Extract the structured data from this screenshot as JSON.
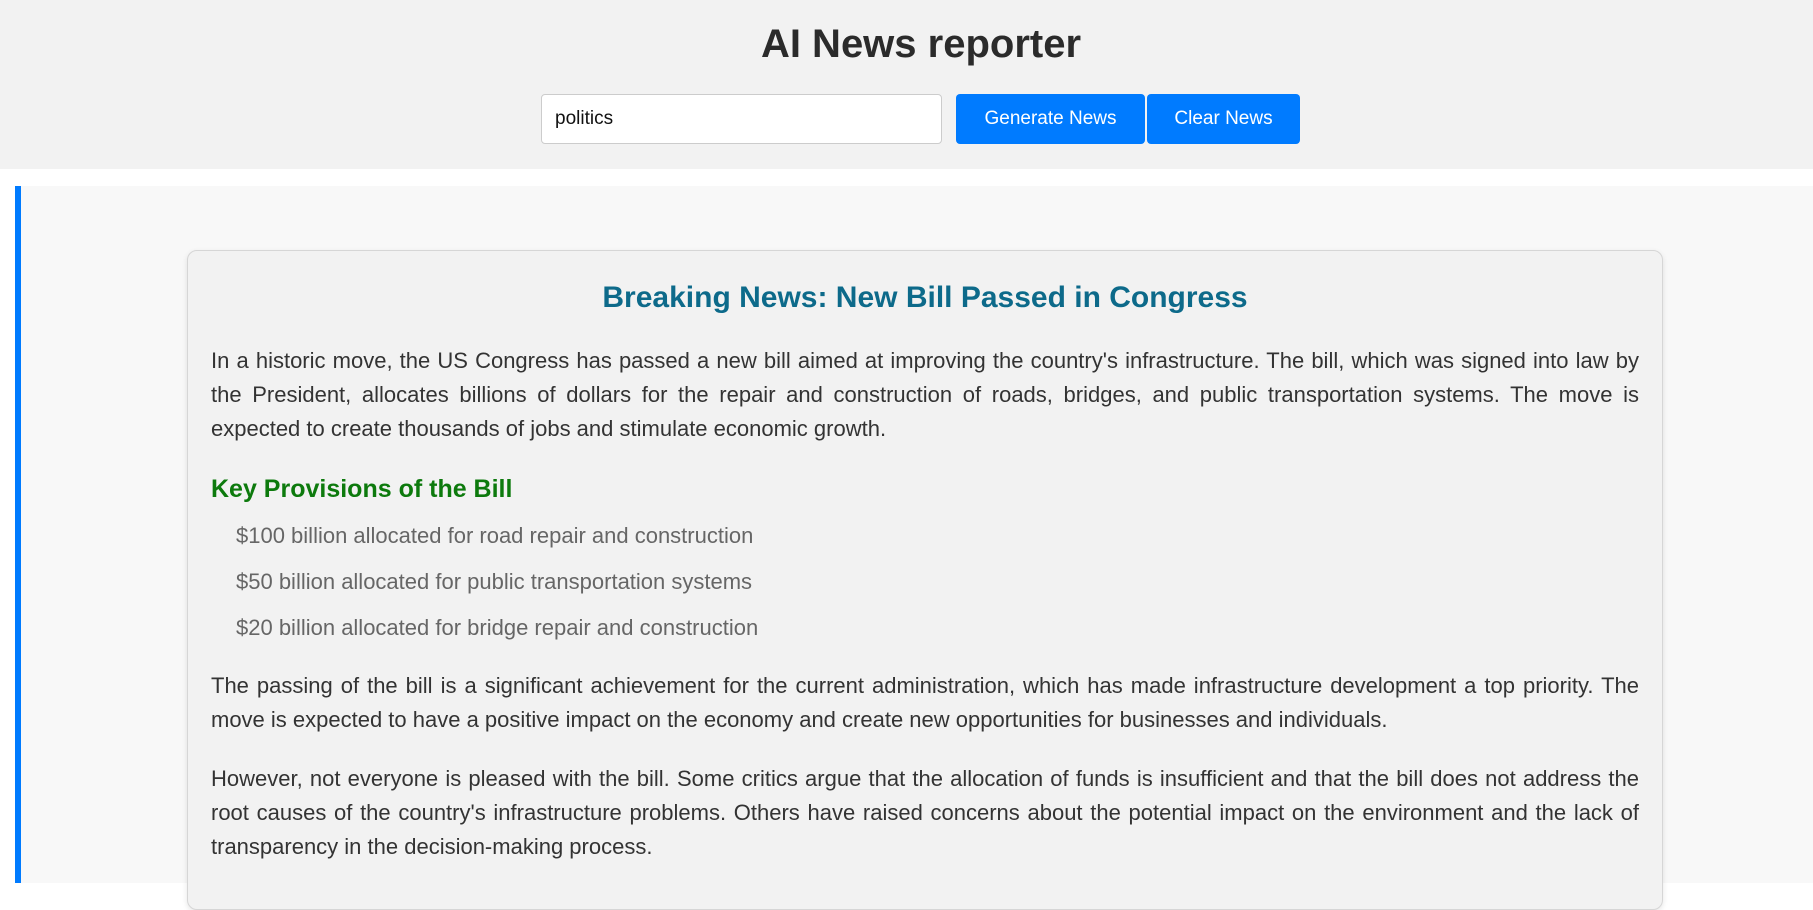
{
  "header": {
    "title": "AI News reporter",
    "topic_input_value": "politics",
    "generate_label": "Generate News",
    "clear_label": "Clear News"
  },
  "colors": {
    "accent": "#007bff",
    "title_color": "#0d6a8a",
    "heading_color": "#0d7a0d"
  },
  "article": {
    "title": "Breaking News: New Bill Passed in Congress",
    "intro": "In a historic move, the US Congress has passed a new bill aimed at improving the country's infrastructure. The bill, which was signed into law by the President, allocates billions of dollars for the repair and construction of roads, bridges, and public transportation systems. The move is expected to create thousands of jobs and stimulate economic growth.",
    "provisions_heading": "Key Provisions of the Bill",
    "provisions": [
      "$100 billion allocated for road repair and construction",
      "$50 billion allocated for public transportation systems",
      "$20 billion allocated for bridge repair and construction"
    ],
    "paragraph_2": "The passing of the bill is a significant achievement for the current administration, which has made infrastructure development a top priority. The move is expected to have a positive impact on the economy and create new opportunities for businesses and individuals.",
    "paragraph_3": "However, not everyone is pleased with the bill. Some critics argue that the allocation of funds is insufficient and that the bill does not address the root causes of the country's infrastructure problems. Others have raised concerns about the potential impact on the environment and the lack of transparency in the decision-making process."
  }
}
